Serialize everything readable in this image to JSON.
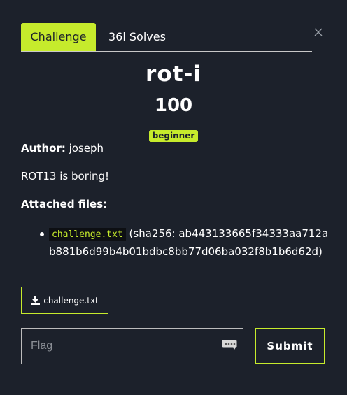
{
  "tabs": {
    "challenge": "Challenge",
    "solves": "36l Solves"
  },
  "challenge": {
    "name": "rot-i",
    "points": "100",
    "tag": "beginner",
    "author_label": "Author:",
    "author": "joseph",
    "description": "ROT13 is boring!",
    "files_heading": "Attached files:",
    "files": [
      {
        "name": "challenge.txt",
        "hash_text": "(sha256: ab443133665f34333aa712ab881b6d99b4b01bdbc8bb77d06ba032f8b1b6d62d)"
      }
    ]
  },
  "download": {
    "label": "challenge.txt"
  },
  "flag": {
    "placeholder": "Flag",
    "value": ""
  },
  "submit": {
    "label": "Submit"
  },
  "colors": {
    "background": "#1c212b",
    "accent": "#c6eb2c",
    "text": "#ffffff",
    "code_background": "#0d0f13"
  },
  "icons": {
    "close": "close-icon",
    "download": "download-icon",
    "password_manager": "password-manager-icon"
  }
}
